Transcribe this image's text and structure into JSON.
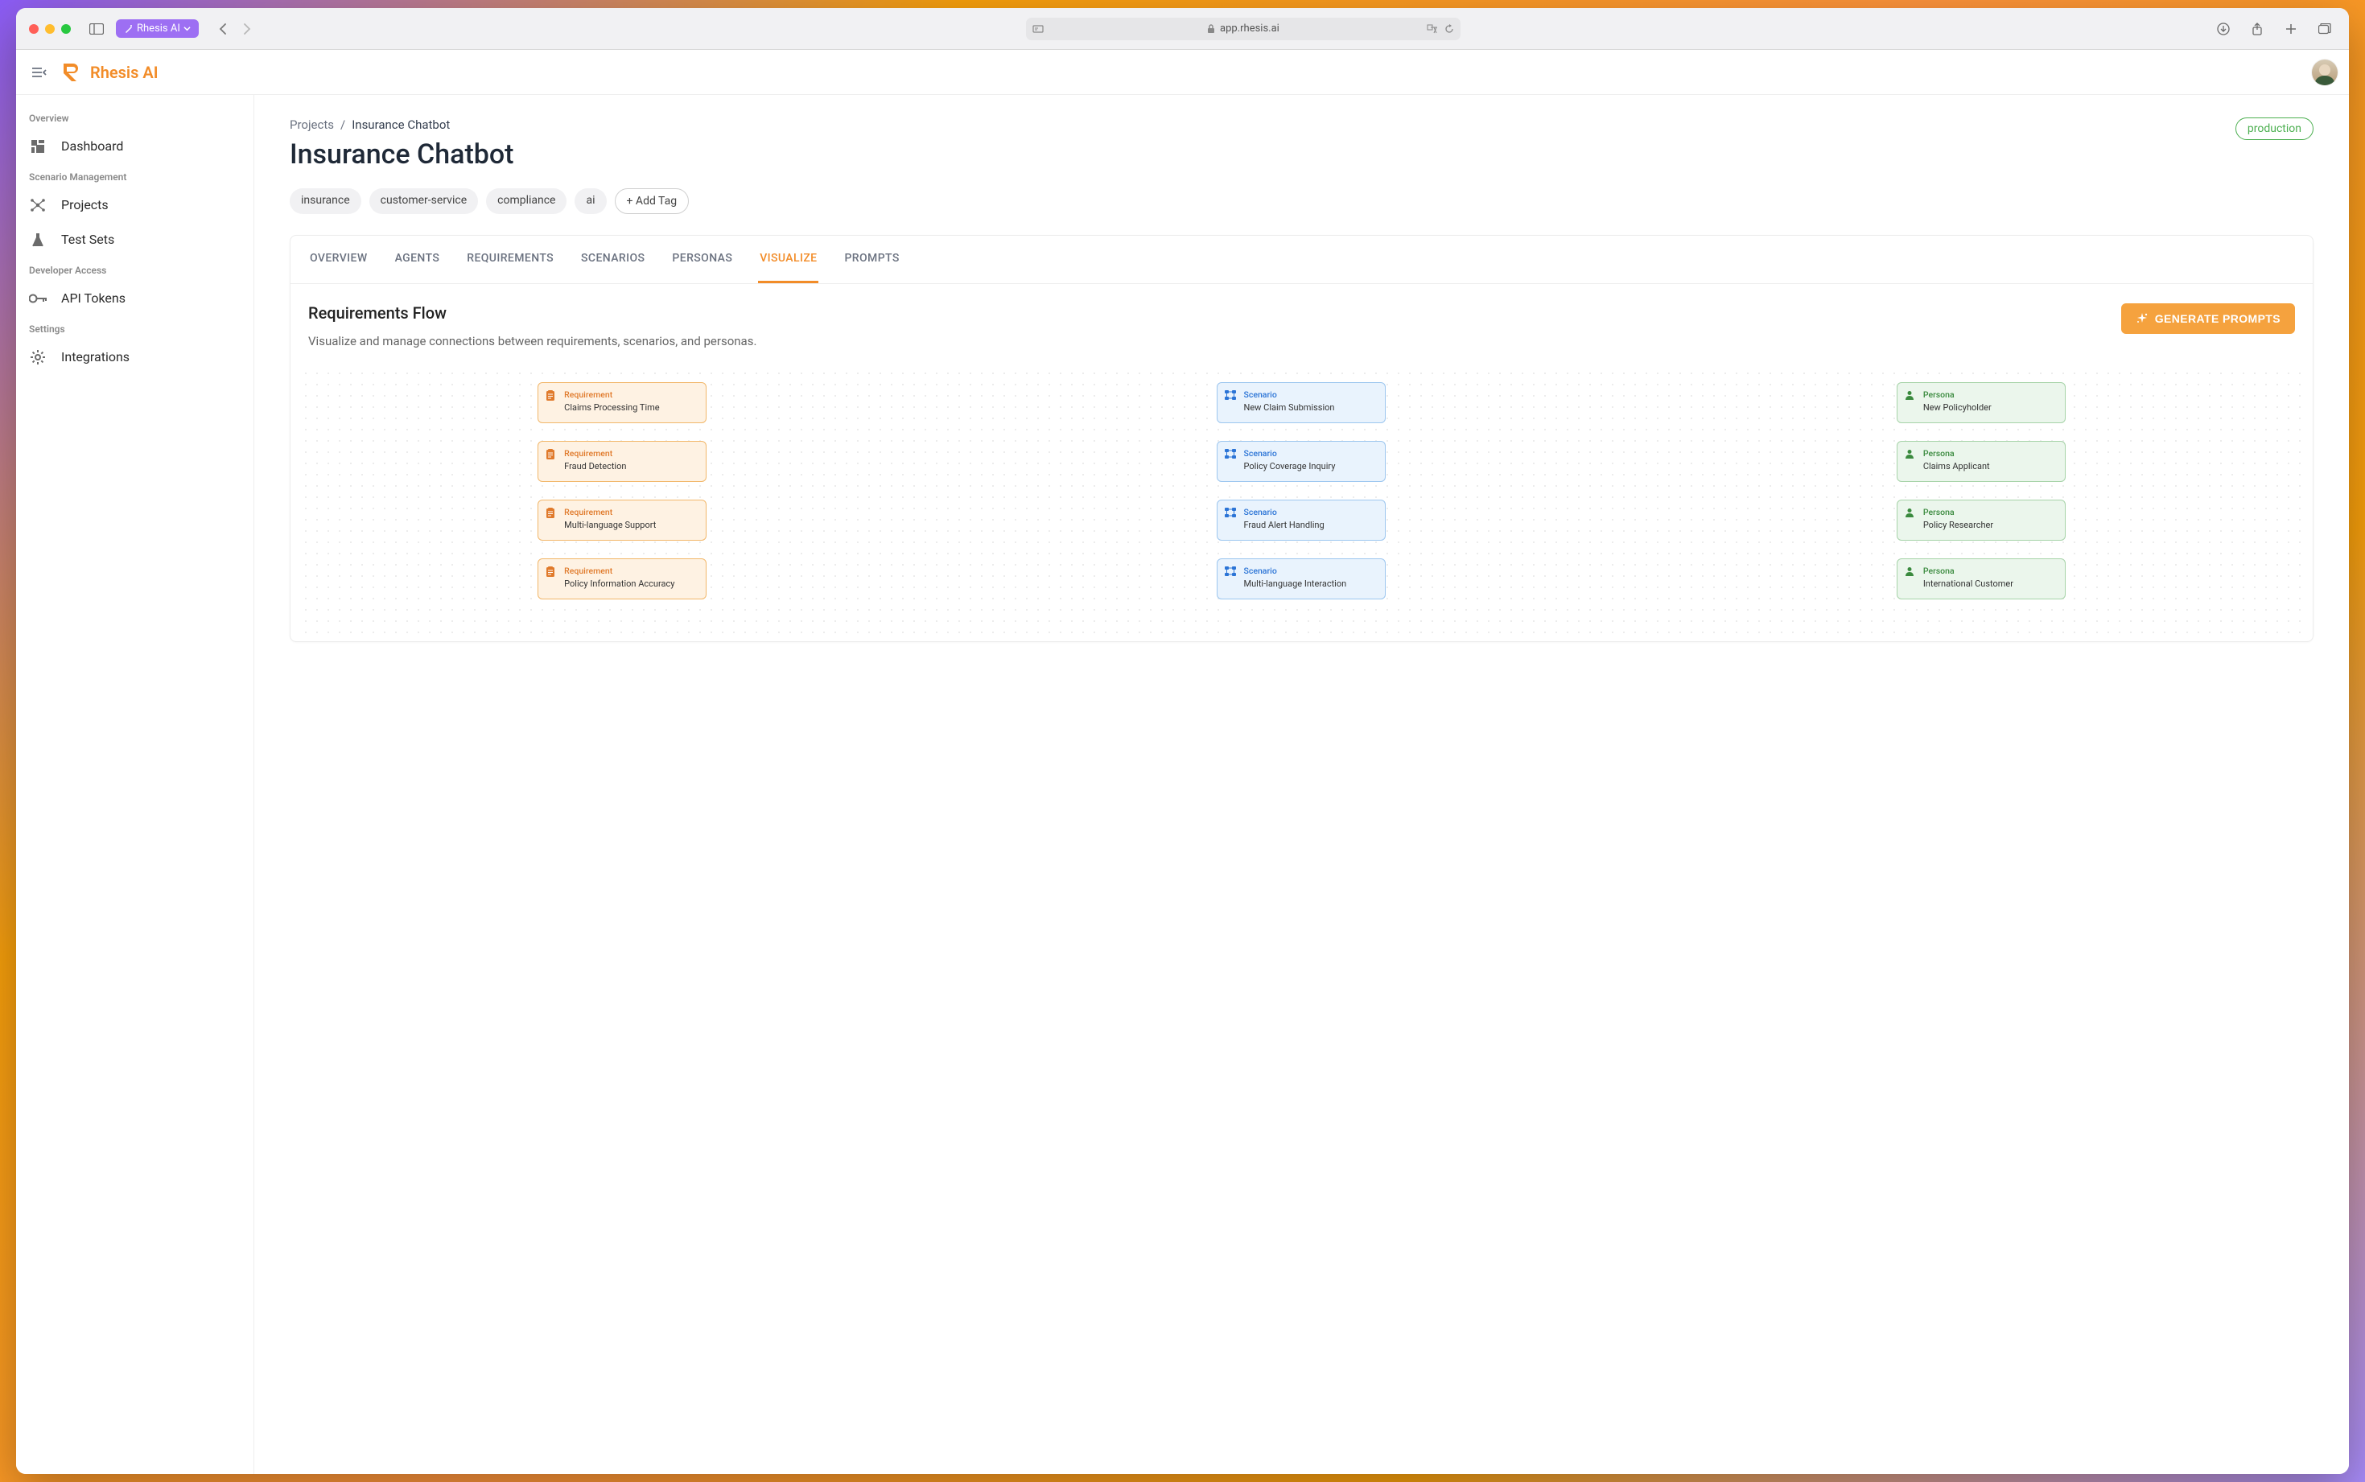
{
  "browser": {
    "tab_label": "Rhesis AI",
    "url_display": "app.rhesis.ai"
  },
  "app": {
    "brand": "Rhesis AI"
  },
  "sidebar": {
    "sections": [
      {
        "label": "Overview",
        "items": [
          {
            "label": "Dashboard",
            "icon": "dashboard"
          }
        ]
      },
      {
        "label": "Scenario Management",
        "items": [
          {
            "label": "Projects",
            "icon": "graph"
          },
          {
            "label": "Test Sets",
            "icon": "flask"
          }
        ]
      },
      {
        "label": "Developer Access",
        "items": [
          {
            "label": "API Tokens",
            "icon": "key"
          }
        ]
      },
      {
        "label": "Settings",
        "items": [
          {
            "label": "Integrations",
            "icon": "gear"
          }
        ]
      }
    ]
  },
  "breadcrumb": {
    "root": "Projects",
    "current": "Insurance Chatbot"
  },
  "page": {
    "title": "Insurance Chatbot",
    "status": "production",
    "tags": [
      "insurance",
      "customer-service",
      "compliance",
      "ai"
    ],
    "add_tag_label": "+ Add Tag"
  },
  "tabs": {
    "items": [
      "OVERVIEW",
      "AGENTS",
      "REQUIREMENTS",
      "SCENARIOS",
      "PERSONAS",
      "VISUALIZE",
      "PROMPTS"
    ],
    "active": "VISUALIZE"
  },
  "panel": {
    "title": "Requirements Flow",
    "subtitle": "Visualize and manage connections between requirements, scenarios, and personas.",
    "generate_label": "GENERATE PROMPTS"
  },
  "flow": {
    "kinds": {
      "req": "Requirement",
      "scn": "Scenario",
      "per": "Persona"
    },
    "rows": [
      {
        "req": "Claims Processing Time",
        "scn": "New Claim Submission",
        "per": "New Policyholder"
      },
      {
        "req": "Fraud Detection",
        "scn": "Policy Coverage Inquiry",
        "per": "Claims Applicant"
      },
      {
        "req": "Multi-language Support",
        "scn": "Fraud Alert Handling",
        "per": "Policy Researcher"
      },
      {
        "req": "Policy Information Accuracy",
        "scn": "Multi-language Interaction",
        "per": "International Customer"
      }
    ]
  }
}
